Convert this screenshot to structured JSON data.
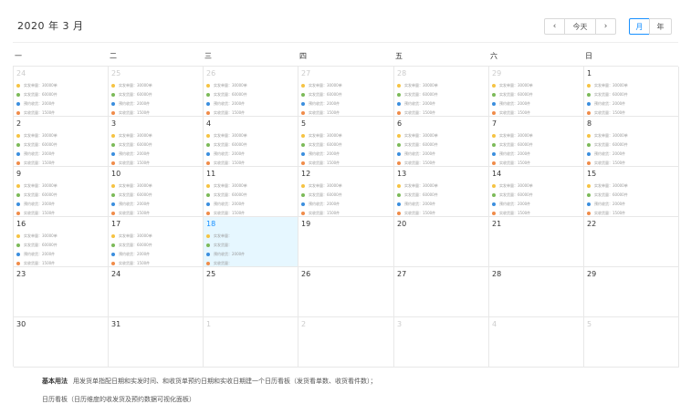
{
  "header": {
    "title": "2020 年 3 月",
    "today_label": "今天",
    "month_label": "月",
    "year_label": "年",
    "prev_icon": "chevron-left-icon",
    "next_icon": "chevron-right-icon",
    "accent_color": "#1890ff"
  },
  "weekdays": [
    "一",
    "二",
    "三",
    "四",
    "五",
    "六",
    "日"
  ],
  "event_colors": [
    "#f5c343",
    "#7cba59",
    "#3b8ede",
    "#f08c4a"
  ],
  "days": [
    {
      "d": "24",
      "other": true,
      "today": false,
      "events": [
        "实发单量：30000单",
        "实发货量：60000件",
        "预约收货：2000件",
        "实收货量：1500件"
      ]
    },
    {
      "d": "25",
      "other": true,
      "today": false,
      "events": [
        "实发单量：30000单",
        "实发货量：60000件",
        "预约收货：2000件",
        "实收货量：1500件"
      ]
    },
    {
      "d": "26",
      "other": true,
      "today": false,
      "events": [
        "实发单量：30000单",
        "实发货量：60000件",
        "预约收货：2000件",
        "实收货量：1500件"
      ]
    },
    {
      "d": "27",
      "other": true,
      "today": false,
      "events": [
        "实发单量：30000单",
        "实发货量：60000件",
        "预约收货：2000件",
        "实收货量：1500件"
      ]
    },
    {
      "d": "28",
      "other": true,
      "today": false,
      "events": [
        "实发单量：30000单",
        "实发货量：60000件",
        "预约收货：2000件",
        "实收货量：1500件"
      ]
    },
    {
      "d": "29",
      "other": true,
      "today": false,
      "events": [
        "实发单量：30000单",
        "实发货量：60000件",
        "预约收货：2000件",
        "实收货量：1500件"
      ]
    },
    {
      "d": "1",
      "other": false,
      "today": false,
      "events": [
        "实发单量：30000单",
        "实发货量：60000件",
        "预约收货：2000件",
        "实收货量：1500件"
      ]
    },
    {
      "d": "2",
      "other": false,
      "today": false,
      "events": [
        "实发单量：30000单",
        "实发货量：60000件",
        "预约收货：2000件",
        "实收货量：1500件"
      ]
    },
    {
      "d": "3",
      "other": false,
      "today": false,
      "events": [
        "实发单量：30000单",
        "实发货量：60000件",
        "预约收货：2000件",
        "实收货量：1500件"
      ]
    },
    {
      "d": "4",
      "other": false,
      "today": false,
      "events": [
        "实发单量：30000单",
        "实发货量：60000件",
        "预约收货：2000件",
        "实收货量：1500件"
      ]
    },
    {
      "d": "5",
      "other": false,
      "today": false,
      "events": [
        "实发单量：30000单",
        "实发货量：60000件",
        "预约收货：2000件",
        "实收货量：1500件"
      ]
    },
    {
      "d": "6",
      "other": false,
      "today": false,
      "events": [
        "实发单量：30000单",
        "实发货量：60000件",
        "预约收货：2000件",
        "实收货量：1500件"
      ]
    },
    {
      "d": "7",
      "other": false,
      "today": false,
      "events": [
        "实发单量：30000单",
        "实发货量：60000件",
        "预约收货：2000件",
        "实收货量：1500件"
      ]
    },
    {
      "d": "8",
      "other": false,
      "today": false,
      "events": [
        "实发单量：30000单",
        "实发货量：60000件",
        "预约收货：2000件",
        "实收货量：1500件"
      ]
    },
    {
      "d": "9",
      "other": false,
      "today": false,
      "events": [
        "实发单量：30000单",
        "实发货量：60000件",
        "预约收货：2000件",
        "实收货量：1500件"
      ]
    },
    {
      "d": "10",
      "other": false,
      "today": false,
      "events": [
        "实发单量：30000单",
        "实发货量：60000件",
        "预约收货：2000件",
        "实收货量：1500件"
      ]
    },
    {
      "d": "11",
      "other": false,
      "today": false,
      "events": [
        "实发单量：30000单",
        "实发货量：60000件",
        "预约收货：2000件",
        "实收货量：1500件"
      ]
    },
    {
      "d": "12",
      "other": false,
      "today": false,
      "events": [
        "实发单量：30000单",
        "实发货量：60000件",
        "预约收货：2000件",
        "实收货量：1500件"
      ]
    },
    {
      "d": "13",
      "other": false,
      "today": false,
      "events": [
        "实发单量：30000单",
        "实发货量：60000件",
        "预约收货：2000件",
        "实收货量：1500件"
      ]
    },
    {
      "d": "14",
      "other": false,
      "today": false,
      "events": [
        "实发单量：30000单",
        "实发货量：60000件",
        "预约收货：2000件",
        "实收货量：1500件"
      ]
    },
    {
      "d": "15",
      "other": false,
      "today": false,
      "events": [
        "实发单量：30000单",
        "实发货量：60000件",
        "预约收货：2000件",
        "实收货量：1500件"
      ]
    },
    {
      "d": "16",
      "other": false,
      "today": false,
      "events": [
        "实发单量：30000单",
        "实发货量：60000件",
        "预约收货：2000件",
        "实收货量：1500件"
      ]
    },
    {
      "d": "17",
      "other": false,
      "today": false,
      "events": [
        "实发单量：30000单",
        "实发货量：60000件",
        "预约收货：2000件",
        "实收货量：1500件"
      ]
    },
    {
      "d": "18",
      "other": false,
      "today": true,
      "events": [
        "实发单量：",
        "实发货量：",
        "预约收货：2000件",
        "实收货量："
      ]
    },
    {
      "d": "19",
      "other": false,
      "today": false,
      "events": []
    },
    {
      "d": "20",
      "other": false,
      "today": false,
      "events": []
    },
    {
      "d": "21",
      "other": false,
      "today": false,
      "events": []
    },
    {
      "d": "22",
      "other": false,
      "today": false,
      "events": []
    },
    {
      "d": "23",
      "other": false,
      "today": false,
      "events": []
    },
    {
      "d": "24",
      "other": false,
      "today": false,
      "events": []
    },
    {
      "d": "25",
      "other": false,
      "today": false,
      "events": []
    },
    {
      "d": "26",
      "other": false,
      "today": false,
      "events": []
    },
    {
      "d": "27",
      "other": false,
      "today": false,
      "events": []
    },
    {
      "d": "28",
      "other": false,
      "today": false,
      "events": []
    },
    {
      "d": "29",
      "other": false,
      "today": false,
      "events": []
    },
    {
      "d": "30",
      "other": false,
      "today": false,
      "events": []
    },
    {
      "d": "31",
      "other": false,
      "today": false,
      "events": []
    },
    {
      "d": "1",
      "other": true,
      "today": false,
      "events": []
    },
    {
      "d": "2",
      "other": true,
      "today": false,
      "events": []
    },
    {
      "d": "3",
      "other": true,
      "today": false,
      "events": []
    },
    {
      "d": "4",
      "other": true,
      "today": false,
      "events": []
    },
    {
      "d": "5",
      "other": true,
      "today": false,
      "events": []
    }
  ],
  "footer": {
    "bold": "基本用法",
    "line1": "用发货单指配日期和实发时间、和收货单预约日期和实收日期建一个日历看板（发货看单数、收货看件数）；",
    "line2": "日历看板（日历维度的收发货及预约数据可视化面板）"
  }
}
